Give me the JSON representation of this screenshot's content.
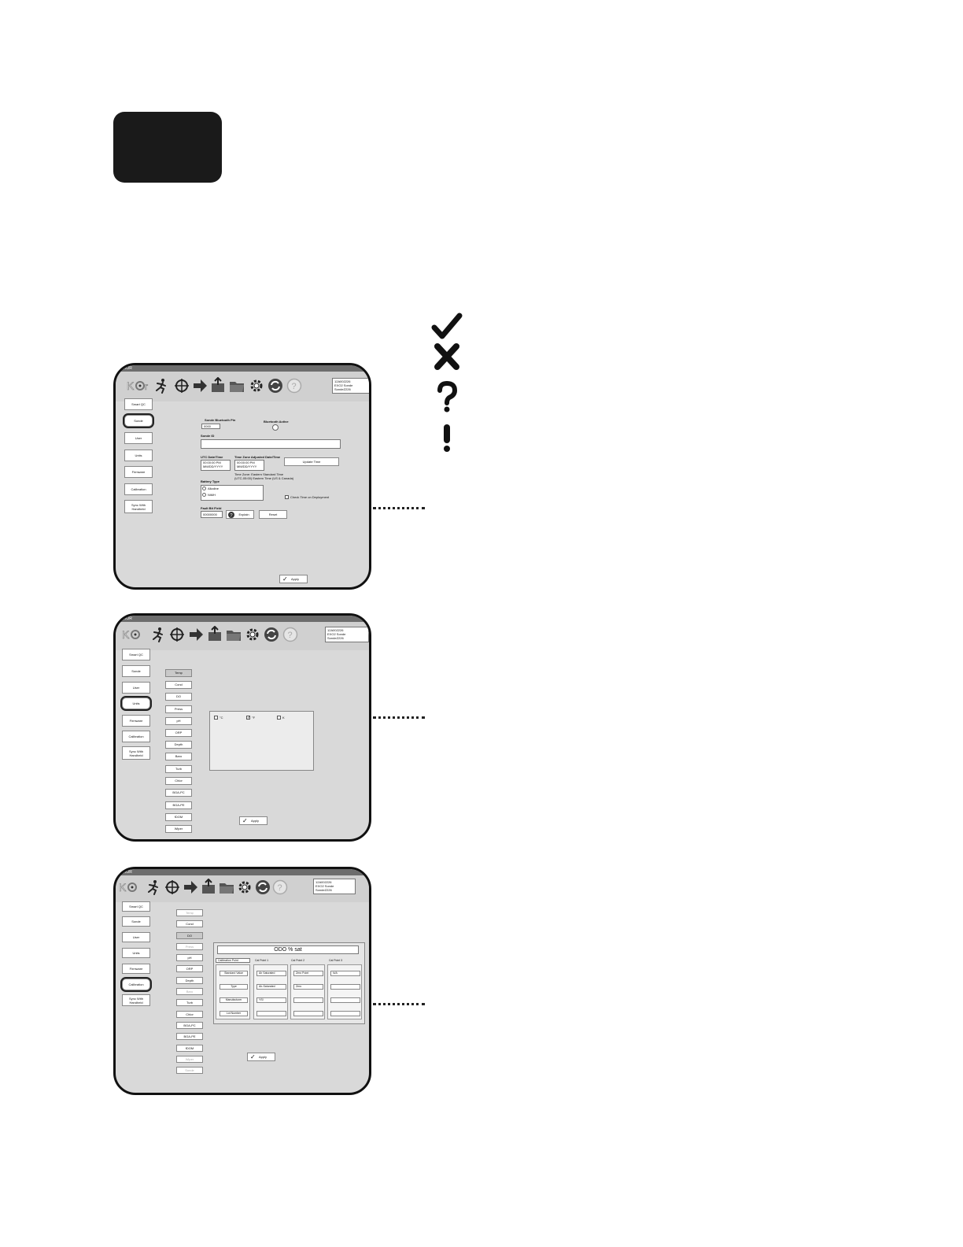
{
  "legend": {
    "icons": [
      "check-icon",
      "x-icon",
      "question-icon",
      "exclamation-icon"
    ]
  },
  "screen1": {
    "title": "KOR",
    "info": [
      "12A002226",
      "EXO2 Sonde",
      "SondeZ226"
    ],
    "nav": [
      "Smart QC",
      "Sonde",
      "User",
      "Units",
      "Firmware",
      "Calibration",
      "Sync With Handheld"
    ],
    "selected_nav": "Sonde",
    "bt_pin_label": "Sonde Bluetooth Pin",
    "bt_pin_value": "0000",
    "bt_active_label": "Bluetooth Active",
    "sonde_id_label": "Sonde ID",
    "utc_label": "UTC Date/Time",
    "utc_time": "00:00:00 PM",
    "utc_date": "MM/DD/YYYY",
    "tz_label": "Time Zone Adjusted Date/Time",
    "tz_time": "00:00:00 PM",
    "tz_date": "MM/DD/YYYY",
    "update_time": "Update Time",
    "tz_line1": "Time Zone: Eastern Standard Time",
    "tz_line2": "(UTC-05:00) Eastern Time (US & Canada)",
    "battery_label": "Battery Type",
    "battery_opt1": "Alkaline",
    "battery_opt2": "NiMH",
    "check_time": "Check Time on Deployment",
    "fault_label": "Fault Bit Field",
    "fault_value": "00000000",
    "explain": "Explain",
    "reset": "Reset",
    "apply": "Apply"
  },
  "screen2": {
    "title": "KOR",
    "info": [
      "12A002226",
      "EXO2 Sonde",
      "SondeZ226"
    ],
    "nav": [
      "Smart QC",
      "Sonde",
      "User",
      "Units",
      "Firmware",
      "Calibration",
      "Sync With Handheld"
    ],
    "selected_nav": "Units",
    "sub": [
      "Temp",
      "Cond",
      "DO",
      "Press",
      "pH",
      "ORP",
      "Depth",
      "Baro",
      "Turb",
      "Chlor",
      "BGA-PC",
      "BGA-PE",
      "fDOM",
      "Wiper"
    ],
    "active_sub": "Temp",
    "units": [
      {
        "label": "°C",
        "checked": false
      },
      {
        "label": "°F",
        "checked": true
      },
      {
        "label": "K",
        "checked": false
      }
    ],
    "apply": "Apply"
  },
  "screen3": {
    "title": "KOR",
    "info": [
      "12A002226",
      "EXO2 Sonde",
      "SondeZ226"
    ],
    "nav": [
      "Smart QC",
      "Sonde",
      "User",
      "Units",
      "Firmware",
      "Calibration",
      "Sync With Handheld"
    ],
    "selected_nav": "Calibration",
    "sub": [
      "Temp",
      "Cond",
      "DO",
      "Press",
      "pH",
      "ORP",
      "Depth",
      "Baro",
      "Turb",
      "Chlor",
      "BGA-PC",
      "BGA-PE",
      "fDOM",
      "Wiper",
      "Sonde"
    ],
    "active_sub": "DO",
    "dim_sub": [
      "Temp",
      "Press",
      "Baro",
      "Wiper",
      "Sonde"
    ],
    "header": "ODO % sat",
    "cal_tab": "Calibration Point",
    "cal_points": [
      "Cal Point 1",
      "Cal Point 2",
      "Cal Point 3"
    ],
    "row_labels": [
      "Standard Value",
      "Type",
      "Manufacturer",
      "Lot Number"
    ],
    "cols": [
      [
        "Air Saturated",
        "Air-Saturated",
        "YSI",
        ""
      ],
      [
        "Zero Point",
        "Zero",
        "",
        ""
      ],
      [
        "N/A",
        "",
        "",
        ""
      ]
    ],
    "apply": "Apply"
  },
  "accent": "#1a1a1a"
}
